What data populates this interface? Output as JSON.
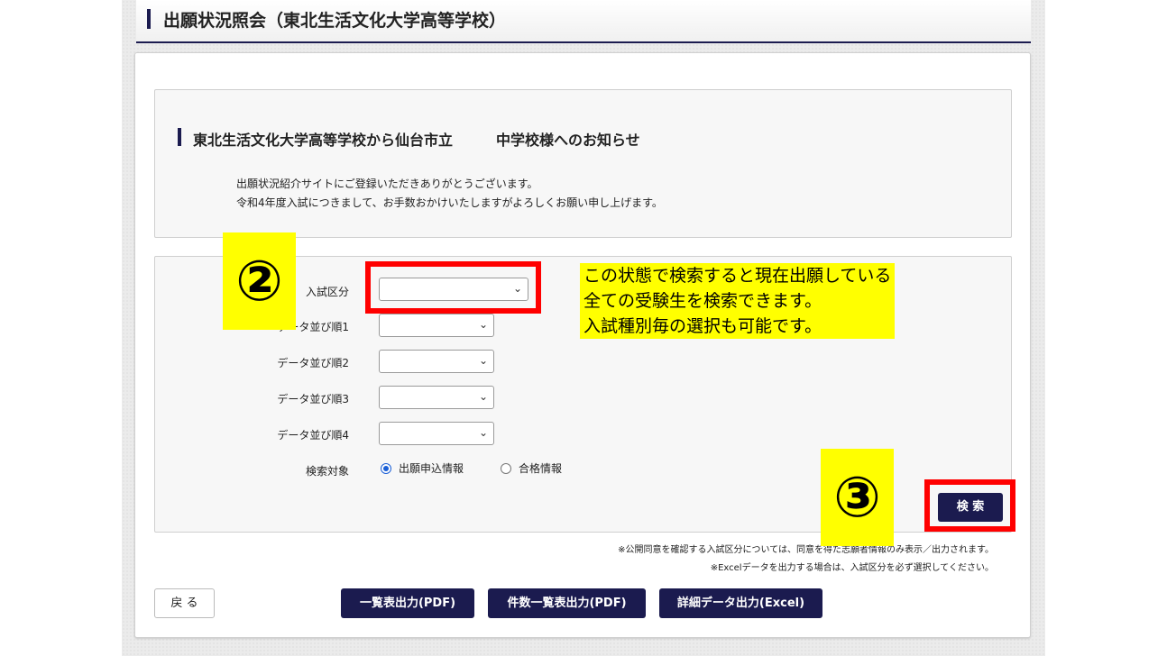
{
  "header": {
    "title": "出願状況照会（東北生活文化大学高等学校）"
  },
  "notice": {
    "title": "東北生活文化大学高等学校から仙台市立　　　中学校様へのお知らせ",
    "message_line1": "出願状況紹介サイトにご登録いただきありがとうございます。",
    "message_line2": "令和4年度入試につきまして、お手数おかけいたしますがよろしくお願い申し上げます。"
  },
  "form": {
    "exam_category_label": "入試区分",
    "sort1_label": "データ並び順1",
    "sort2_label": "データ並び順2",
    "sort3_label": "データ並び順3",
    "sort4_label": "データ並び順4",
    "search_target_label": "検索対象",
    "radio_application": "出願申込情報",
    "radio_pass": "合格情報",
    "selected_radio": "出願申込情報",
    "search_button": "検 索"
  },
  "notes": {
    "note1": "※公開同意を確認する入試区分については、同意を得た志願者情報のみ表示／出力されます。",
    "note2": "※Excelデータを出力する場合は、入試区分を必ず選択してください。"
  },
  "buttons": {
    "back": "戻 る",
    "list_pdf": "一覧表出力(PDF)",
    "count_pdf": "件数一覧表出力(PDF)",
    "detail_excel": "詳細データ出力(Excel)"
  },
  "annotations": {
    "step2": "②",
    "step3": "③",
    "callout_line1": "この状態で検索すると現在出願している",
    "callout_line2": "全ての受験生を検索できます。",
    "callout_line3": "入試種別毎の選択も可能です。",
    "highlight_color": "#ffff00",
    "box_color": "#ff0000"
  },
  "colors": {
    "accent": "#1b1b4f"
  }
}
